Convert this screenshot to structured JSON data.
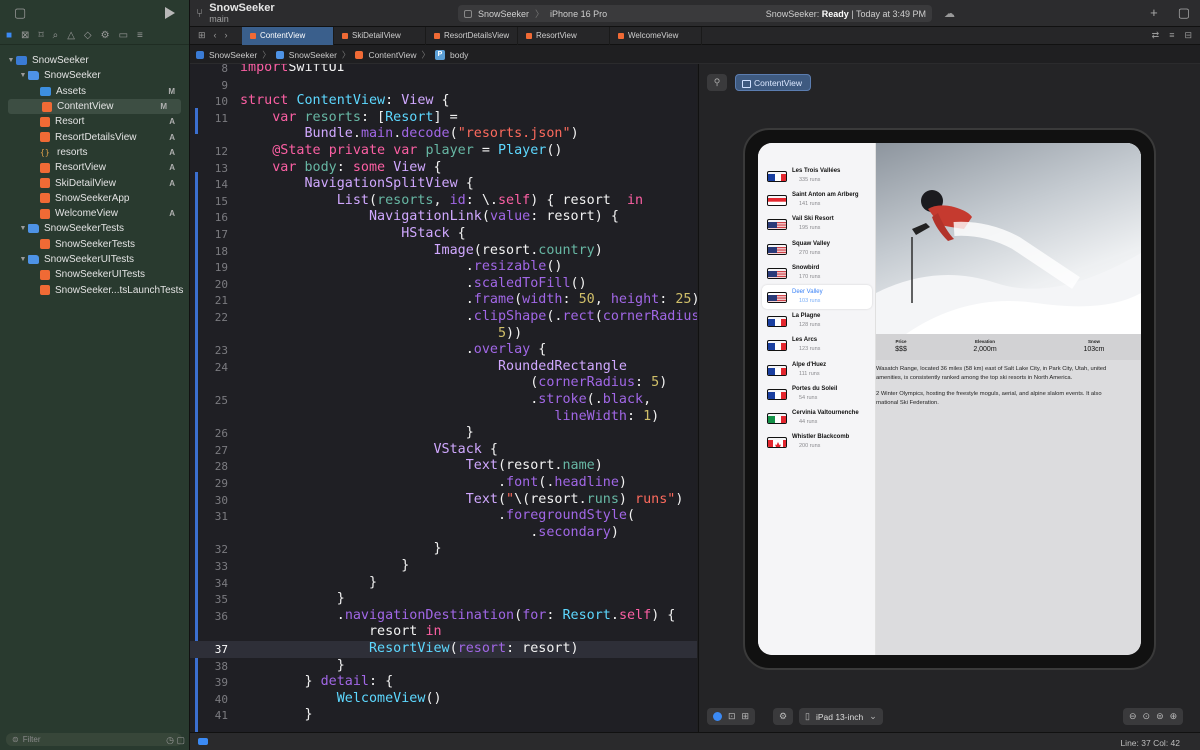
{
  "toolbar": {
    "project": "SnowSeeker",
    "branch": "main",
    "scheme": "SnowSeeker",
    "device": "iPhone 16 Pro",
    "status_app": "SnowSeeker:",
    "status_state": "Ready",
    "status_time": "| Today at 3:49 PM"
  },
  "tabs": [
    "ContentView",
    "SkiDetailView",
    "ResortDetailsView",
    "ResortView",
    "WelcomeView"
  ],
  "breadcrumb": [
    "SnowSeeker",
    "SnowSeeker",
    "ContentView",
    "body"
  ],
  "navigator": {
    "items": [
      {
        "label": "SnowSeeker",
        "kind": "proj",
        "level": 0,
        "disclosure": "open",
        "badge": ""
      },
      {
        "label": "SnowSeeker",
        "kind": "folder",
        "level": 1,
        "disclosure": "open",
        "badge": ""
      },
      {
        "label": "Assets",
        "kind": "assets",
        "level": 2,
        "disclosure": "",
        "badge": "M"
      },
      {
        "label": "ContentView",
        "kind": "swift",
        "level": 2,
        "disclosure": "",
        "badge": "M",
        "selected": true
      },
      {
        "label": "Resort",
        "kind": "swift",
        "level": 2,
        "disclosure": "",
        "badge": "A"
      },
      {
        "label": "ResortDetailsView",
        "kind": "swift",
        "level": 2,
        "disclosure": "",
        "badge": "A"
      },
      {
        "label": "resorts",
        "kind": "json",
        "level": 2,
        "disclosure": "",
        "badge": "A"
      },
      {
        "label": "ResortView",
        "kind": "swift",
        "level": 2,
        "disclosure": "",
        "badge": "A"
      },
      {
        "label": "SkiDetailView",
        "kind": "swift",
        "level": 2,
        "disclosure": "",
        "badge": "A"
      },
      {
        "label": "SnowSeekerApp",
        "kind": "swift",
        "level": 2,
        "disclosure": "",
        "badge": ""
      },
      {
        "label": "WelcomeView",
        "kind": "swift",
        "level": 2,
        "disclosure": "",
        "badge": "A"
      },
      {
        "label": "SnowSeekerTests",
        "kind": "folder",
        "level": 1,
        "disclosure": "open",
        "badge": ""
      },
      {
        "label": "SnowSeekerTests",
        "kind": "swift",
        "level": 2,
        "disclosure": "",
        "badge": ""
      },
      {
        "label": "SnowSeekerUITests",
        "kind": "folder",
        "level": 1,
        "disclosure": "open",
        "badge": ""
      },
      {
        "label": "SnowSeekerUITests",
        "kind": "swift",
        "level": 2,
        "disclosure": "",
        "badge": ""
      },
      {
        "label": "SnowSeeker...tsLaunchTests",
        "kind": "swift",
        "level": 2,
        "disclosure": "",
        "badge": ""
      }
    ],
    "filter_placeholder": "Filter"
  },
  "code": {
    "current_line": 37,
    "lines": [
      {
        "n": "8",
        "t": [
          [
            "kw",
            "import"
          ],
          [
            "",
            "SwiftUI"
          ]
        ]
      },
      {
        "n": "9",
        "t": []
      },
      {
        "n": "10",
        "t": [
          [
            "kw",
            "struct"
          ],
          [
            "",
            " "
          ],
          [
            "tp",
            "ContentView"
          ],
          [
            "",
            ": "
          ],
          [
            "ty",
            "View"
          ],
          [
            "",
            " {"
          ]
        ]
      },
      {
        "n": "11",
        "t": [
          [
            "",
            "    "
          ],
          [
            "kw",
            "var"
          ],
          [
            "",
            " "
          ],
          [
            "pr",
            "resorts"
          ],
          [
            "",
            ": ["
          ],
          [
            "tp",
            "Resort"
          ],
          [
            "",
            "] ="
          ]
        ]
      },
      {
        "n": "",
        "t": [
          [
            "",
            "        "
          ],
          [
            "ty",
            "Bundle"
          ],
          [
            "",
            "."
          ],
          [
            "fn",
            "main"
          ],
          [
            "",
            "."
          ],
          [
            "fn",
            "decode"
          ],
          [
            "",
            "("
          ],
          [
            "st",
            "\"resorts.json\""
          ],
          [
            "",
            ")"
          ]
        ]
      },
      {
        "n": "12",
        "t": [
          [
            "",
            "    "
          ],
          [
            "kw",
            "@State"
          ],
          [
            "",
            " "
          ],
          [
            "kw",
            "private"
          ],
          [
            "",
            " "
          ],
          [
            "kw",
            "var"
          ],
          [
            "",
            " "
          ],
          [
            "pr",
            "player"
          ],
          [
            "",
            " = "
          ],
          [
            "tp",
            "Player"
          ],
          [
            "",
            "()"
          ]
        ]
      },
      {
        "n": "13",
        "t": [
          [
            "",
            "    "
          ],
          [
            "kw",
            "var"
          ],
          [
            "",
            " "
          ],
          [
            "pr",
            "body"
          ],
          [
            "",
            ": "
          ],
          [
            "kw",
            "some"
          ],
          [
            "",
            " "
          ],
          [
            "ty",
            "View"
          ],
          [
            "",
            " {"
          ]
        ]
      },
      {
        "n": "14",
        "t": [
          [
            "",
            "        "
          ],
          [
            "ty",
            "NavigationSplitView"
          ],
          [
            "",
            " {"
          ]
        ]
      },
      {
        "n": "15",
        "t": [
          [
            "",
            "            "
          ],
          [
            "ty",
            "List"
          ],
          [
            "",
            "("
          ],
          [
            "pr",
            "resorts"
          ],
          [
            "",
            ", "
          ],
          [
            "fn",
            "id"
          ],
          [
            "",
            ": \\."
          ],
          [
            "kw",
            "self"
          ],
          [
            "",
            ") { resort  "
          ],
          [
            "kw",
            "in"
          ]
        ]
      },
      {
        "n": "16",
        "t": [
          [
            "",
            "                "
          ],
          [
            "ty",
            "NavigationLink"
          ],
          [
            "",
            "("
          ],
          [
            "fn",
            "value"
          ],
          [
            "",
            ": resort) {"
          ]
        ]
      },
      {
        "n": "17",
        "t": [
          [
            "",
            "                    "
          ],
          [
            "ty",
            "HStack"
          ],
          [
            "",
            " {"
          ]
        ]
      },
      {
        "n": "18",
        "t": [
          [
            "",
            "                        "
          ],
          [
            "ty",
            "Image"
          ],
          [
            "",
            "(resort."
          ],
          [
            "pr",
            "country"
          ],
          [
            "",
            ")"
          ]
        ]
      },
      {
        "n": "19",
        "t": [
          [
            "",
            "                            ."
          ],
          [
            "fn",
            "resizable"
          ],
          [
            "",
            "()"
          ]
        ]
      },
      {
        "n": "20",
        "t": [
          [
            "",
            "                            ."
          ],
          [
            "fn",
            "scaledToFill"
          ],
          [
            "",
            "()"
          ]
        ]
      },
      {
        "n": "21",
        "t": [
          [
            "",
            "                            ."
          ],
          [
            "fn",
            "frame"
          ],
          [
            "",
            "("
          ],
          [
            "fn",
            "width"
          ],
          [
            "",
            ": "
          ],
          [
            "nu",
            "50"
          ],
          [
            "",
            ", "
          ],
          [
            "fn",
            "height"
          ],
          [
            "",
            ": "
          ],
          [
            "nu",
            "25"
          ],
          [
            "",
            ")"
          ]
        ]
      },
      {
        "n": "22",
        "t": [
          [
            "",
            "                            ."
          ],
          [
            "fn",
            "clipShape"
          ],
          [
            "",
            "(."
          ],
          [
            "fn",
            "rect"
          ],
          [
            "",
            "("
          ],
          [
            "fn",
            "cornerRadius"
          ],
          [
            "",
            ":"
          ]
        ]
      },
      {
        "n": "",
        "t": [
          [
            "",
            "                                "
          ],
          [
            "nu",
            "5"
          ],
          [
            "",
            "))"
          ]
        ]
      },
      {
        "n": "23",
        "t": [
          [
            "",
            "                            ."
          ],
          [
            "fn",
            "overlay"
          ],
          [
            "",
            " {"
          ]
        ]
      },
      {
        "n": "24",
        "t": [
          [
            "",
            "                                "
          ],
          [
            "ty",
            "RoundedRectangle"
          ]
        ]
      },
      {
        "n": "",
        "t": [
          [
            "",
            "                                    ("
          ],
          [
            "fn",
            "cornerRadius"
          ],
          [
            "",
            ": "
          ],
          [
            "nu",
            "5"
          ],
          [
            "",
            ")"
          ]
        ]
      },
      {
        "n": "25",
        "t": [
          [
            "",
            "                                    ."
          ],
          [
            "fn",
            "stroke"
          ],
          [
            "",
            "(."
          ],
          [
            "fn",
            "black"
          ],
          [
            "",
            ","
          ]
        ]
      },
      {
        "n": "",
        "t": [
          [
            "",
            "                                       "
          ],
          [
            "fn",
            "lineWidth"
          ],
          [
            "",
            ": "
          ],
          [
            "nu",
            "1"
          ],
          [
            "",
            ")"
          ]
        ]
      },
      {
        "n": "26",
        "t": [
          [
            "",
            "                            }"
          ]
        ]
      },
      {
        "n": "27",
        "t": [
          [
            "",
            "                        "
          ],
          [
            "ty",
            "VStack"
          ],
          [
            "",
            " {"
          ]
        ]
      },
      {
        "n": "28",
        "t": [
          [
            "",
            "                            "
          ],
          [
            "ty",
            "Text"
          ],
          [
            "",
            "(resort."
          ],
          [
            "pr",
            "name"
          ],
          [
            "",
            ")"
          ]
        ]
      },
      {
        "n": "29",
        "t": [
          [
            "",
            "                                ."
          ],
          [
            "fn",
            "font"
          ],
          [
            "",
            "(."
          ],
          [
            "fn",
            "headline"
          ],
          [
            "",
            ")"
          ]
        ]
      },
      {
        "n": "30",
        "t": [
          [
            "",
            "                            "
          ],
          [
            "ty",
            "Text"
          ],
          [
            "",
            "("
          ],
          [
            "st",
            "\""
          ],
          [
            "",
            "\\(resort."
          ],
          [
            "pr",
            "runs"
          ],
          [
            "",
            ")"
          ],
          [
            "st",
            " runs\""
          ],
          [
            "",
            ")"
          ]
        ]
      },
      {
        "n": "31",
        "t": [
          [
            "",
            "                                ."
          ],
          [
            "fn",
            "foregroundStyle"
          ],
          [
            "",
            "("
          ]
        ]
      },
      {
        "n": "",
        "t": [
          [
            "",
            "                                    ."
          ],
          [
            "fn",
            "secondary"
          ],
          [
            "",
            ")"
          ]
        ]
      },
      {
        "n": "32",
        "t": [
          [
            "",
            "                        }"
          ]
        ]
      },
      {
        "n": "33",
        "t": [
          [
            "",
            "                    }"
          ]
        ]
      },
      {
        "n": "34",
        "t": [
          [
            "",
            "                }"
          ]
        ]
      },
      {
        "n": "35",
        "t": [
          [
            "",
            "            }"
          ]
        ]
      },
      {
        "n": "36",
        "t": [
          [
            "",
            "            ."
          ],
          [
            "fn",
            "navigationDestination"
          ],
          [
            "",
            "("
          ],
          [
            "fn",
            "for"
          ],
          [
            "",
            ": "
          ],
          [
            "tp",
            "Resort"
          ],
          [
            "",
            "."
          ],
          [
            "kw",
            "self"
          ],
          [
            "",
            ") {"
          ]
        ]
      },
      {
        "n": "",
        "t": [
          [
            "",
            "                resort "
          ],
          [
            "kw",
            "in"
          ]
        ]
      },
      {
        "n": "37",
        "t": [
          [
            "",
            "                "
          ],
          [
            "tp",
            "ResortView"
          ],
          [
            "",
            "("
          ],
          [
            "fn",
            "resort"
          ],
          [
            "",
            ": resort)"
          ]
        ]
      },
      {
        "n": "38",
        "t": [
          [
            "",
            "            }"
          ]
        ]
      },
      {
        "n": "39",
        "t": [
          [
            "",
            "        } "
          ],
          [
            "fn",
            "detail"
          ],
          [
            "",
            ": {"
          ]
        ]
      },
      {
        "n": "40",
        "t": [
          [
            "",
            "            "
          ],
          [
            "tp",
            "WelcomeView"
          ],
          [
            "",
            "()"
          ]
        ]
      },
      {
        "n": "41",
        "t": [
          [
            "",
            "        }"
          ]
        ]
      }
    ]
  },
  "preview": {
    "chip": "ContentView",
    "device": "iPad 13-inch",
    "resorts": [
      {
        "name": "Les Trois Vallées",
        "runs": "335 runs",
        "flag": "fr"
      },
      {
        "name": "Saint Anton am Arlberg",
        "runs": "141 runs",
        "flag": "at"
      },
      {
        "name": "Vail Ski Resort",
        "runs": "195 runs",
        "flag": "us"
      },
      {
        "name": "Squaw Valley",
        "runs": "270 runs",
        "flag": "us"
      },
      {
        "name": "Snowbird",
        "runs": "170 runs",
        "flag": "us"
      },
      {
        "name": "Deer Valley",
        "runs": "103 runs",
        "flag": "us",
        "selected": true
      },
      {
        "name": "La Plagne",
        "runs": "128 runs",
        "flag": "fr"
      },
      {
        "name": "Les Arcs",
        "runs": "123 runs",
        "flag": "fr"
      },
      {
        "name": "Alpe d'Huez",
        "runs": "111 runs",
        "flag": "fr"
      },
      {
        "name": "Portes du Soleil",
        "runs": "54 runs",
        "flag": "fr"
      },
      {
        "name": "Cervinia Valtournenche",
        "runs": "44 runs",
        "flag": "it"
      },
      {
        "name": "Whistler Blackcomb",
        "runs": "200 runs",
        "flag": "ca"
      }
    ],
    "stats": [
      {
        "key": "Price",
        "value": "$$$"
      },
      {
        "key": "Elevation",
        "value": "2,000m"
      },
      {
        "key": "Snow",
        "value": "103cm"
      }
    ],
    "desc_1a": "Wasatch Range, located 36 miles (58 km) east of Salt Lake City, in Park City, Utah, united",
    "desc_1b": " amenities, is consistently ranked among the top ski resorts in North America.",
    "desc_2a": "2 Winter Olympics, hosting the freestyle moguls, aerial, and alpine slalom events. It also",
    "desc_2b": "rnational Ski Federation."
  },
  "statusbar": {
    "position": "Line: 37  Col: 42"
  }
}
